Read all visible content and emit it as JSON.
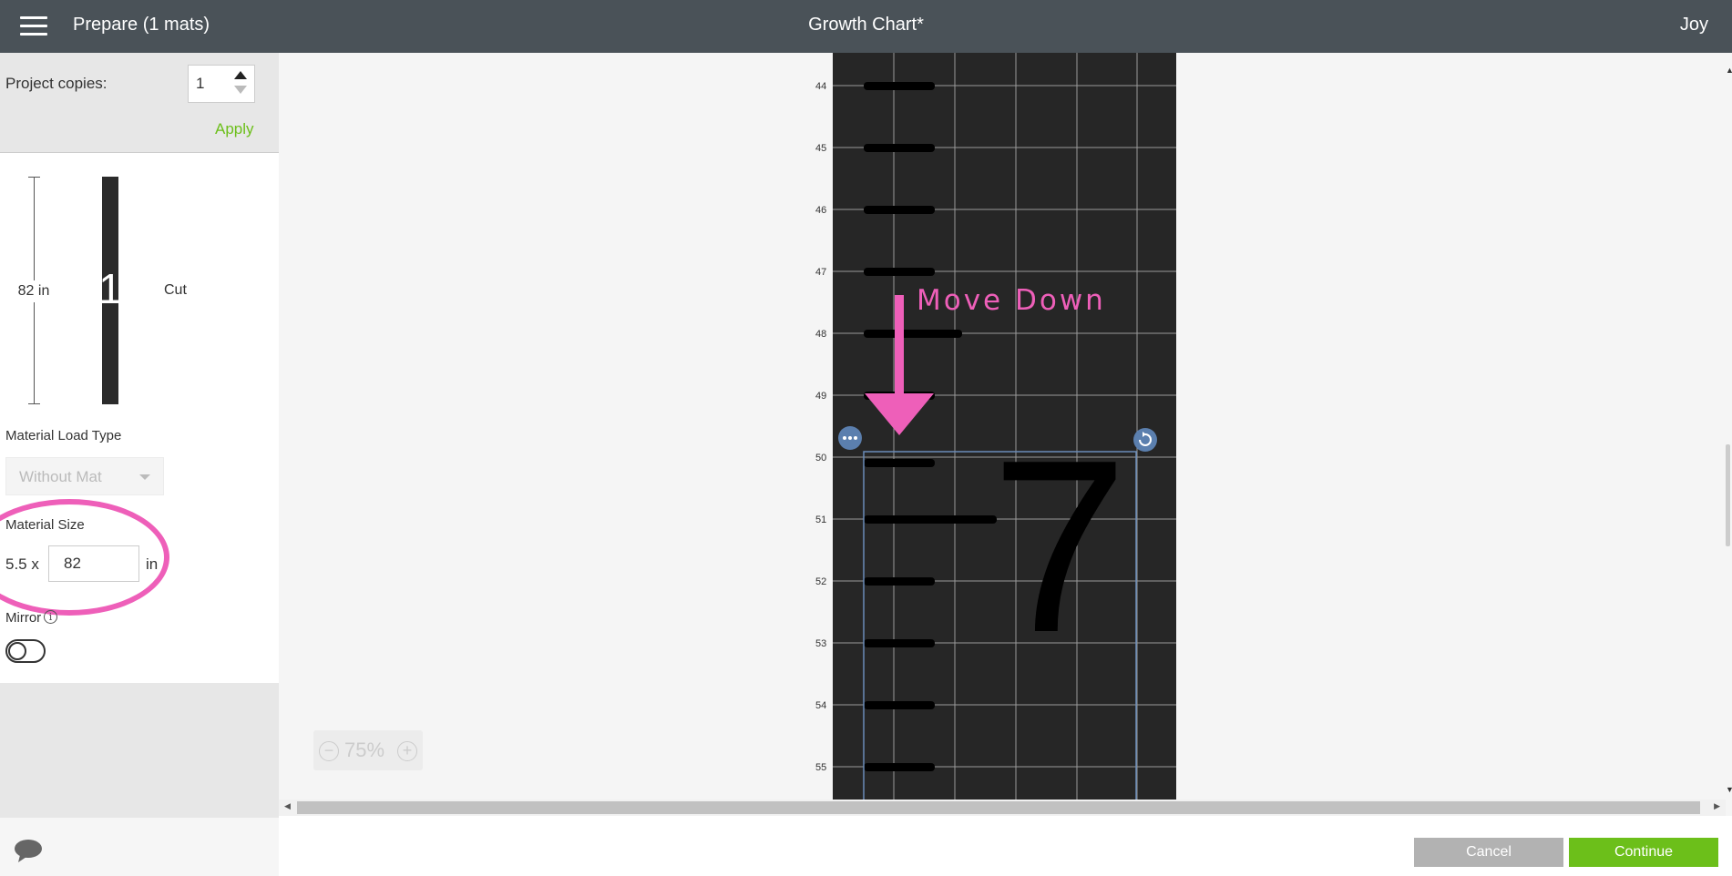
{
  "header": {
    "menu_icon": "hamburger-menu-icon",
    "title": "Prepare (1 mats)",
    "document_title": "Growth Chart*",
    "user": "Joy"
  },
  "sidebar": {
    "project_copies_label": "Project copies:",
    "project_copies_value": "1",
    "apply_label": "Apply",
    "mat_length_label": "82 in",
    "mat_number": "1",
    "mat_mode": "Cut",
    "material_load_type_label": "Material Load Type",
    "material_load_type_value": "Without Mat",
    "material_size_label": "Material Size",
    "material_width": "5.5 x",
    "material_length_value": "82",
    "material_unit": "in",
    "mirror_label": "Mirror",
    "mirror_on": false,
    "chat_icon": "speech-bubble-icon"
  },
  "canvas": {
    "ruler_ticks": [
      "44",
      "45",
      "46",
      "47",
      "48",
      "49",
      "50",
      "51",
      "52",
      "53",
      "54",
      "55"
    ],
    "annotation_text": "Move Down",
    "selected_glyph": "7",
    "zoom_value": "75%",
    "zoom_out_label": "−",
    "zoom_in_label": "+"
  },
  "footer": {
    "cancel_label": "Cancel",
    "continue_label": "Continue"
  },
  "colors": {
    "header_bg": "#4a5258",
    "accent_green": "#6cbf1a",
    "mat_bg": "#262626",
    "annotation_pink": "#ee5fb9",
    "selection_blue": "#6a8cb8"
  }
}
